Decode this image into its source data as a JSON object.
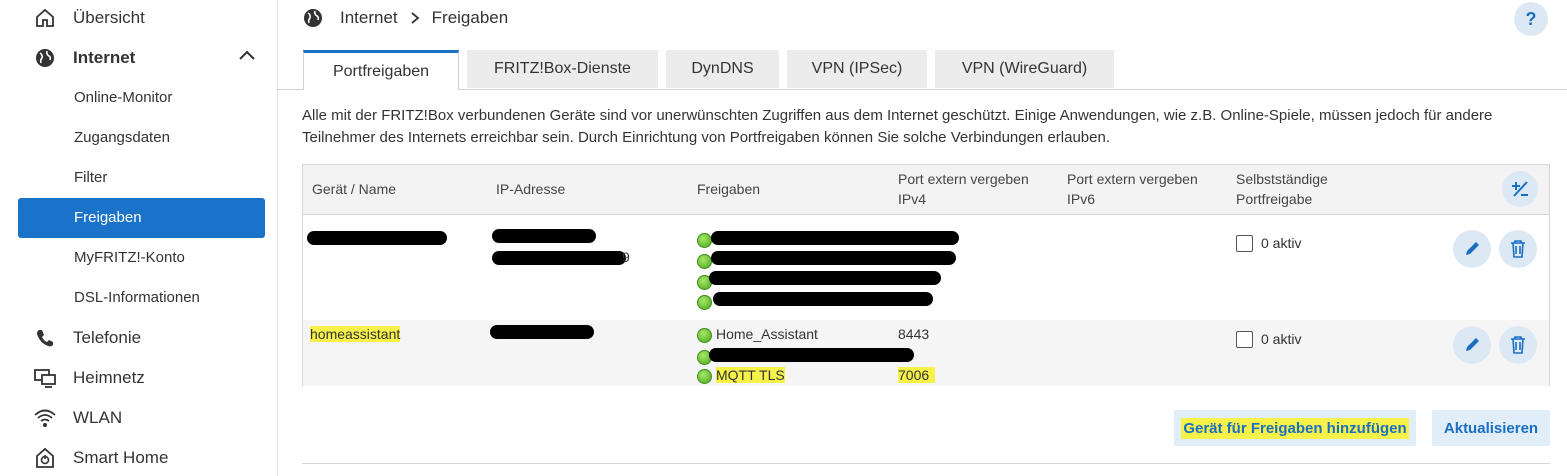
{
  "sidebar": {
    "items": [
      {
        "label": "Übersicht",
        "icon": "home-icon"
      },
      {
        "label": "Internet",
        "icon": "globe-icon"
      },
      {
        "label": "Telefonie",
        "icon": "phone-icon"
      },
      {
        "label": "Heimnetz",
        "icon": "network-icon"
      },
      {
        "label": "WLAN",
        "icon": "wifi-icon"
      },
      {
        "label": "Smart Home",
        "icon": "smarthome-icon"
      }
    ],
    "internet_sub": [
      "Online-Monitor",
      "Zugangsdaten",
      "Filter",
      "Freigaben",
      "MyFRITZ!-Konto",
      "DSL-Informationen"
    ],
    "active_sub": "Freigaben"
  },
  "breadcrumb": {
    "root": "Internet",
    "current": "Freigaben",
    "help": "?"
  },
  "tabs": [
    "Portfreigaben",
    "FRITZ!Box-Dienste",
    "DynDNS",
    "VPN (IPSec)",
    "VPN (WireGuard)"
  ],
  "active_tab": "Portfreigaben",
  "intro": {
    "line1": "Alle mit der FRITZ!Box verbundenen Geräte sind vor unerwünschten Zugriffen aus dem Internet geschützt. Einige Anwendungen, wie z.B. Online-Spiele, müssen jedoch für andere",
    "line2": "Teilnehmer des Internets erreichbar sein. Durch Einrichtung von Portfreigaben können Sie solche Verbindungen erlauben."
  },
  "table": {
    "headers": {
      "name": "Gerät / Name",
      "ip": "IP-Adresse",
      "shares": "Freigaben",
      "ipv4_a": "Port extern vergeben",
      "ipv4_b": "IPv4",
      "ipv6_a": "Port extern vergeben",
      "ipv6_b": "IPv6",
      "self_a": "Selbstständige",
      "self_b": "Portfreigabe"
    },
    "rows": [
      {
        "name": "",
        "ip_suffix": "9",
        "shares": [
          "",
          "",
          "",
          ""
        ],
        "self_label": "0 aktiv"
      },
      {
        "name": "homeassistant",
        "shares": [
          "Home_Assistant",
          "",
          "MQTT TLS"
        ],
        "ports": [
          "8443",
          "",
          "7006"
        ],
        "self_label": "0 aktiv"
      }
    ]
  },
  "buttons": {
    "add": "Gerät für Freigaben hinzufügen",
    "refresh": "Aktualisieren"
  },
  "colors": {
    "accent": "#1a73c8",
    "highlight": "#f7f24a",
    "button_bg": "#e1edf8"
  }
}
